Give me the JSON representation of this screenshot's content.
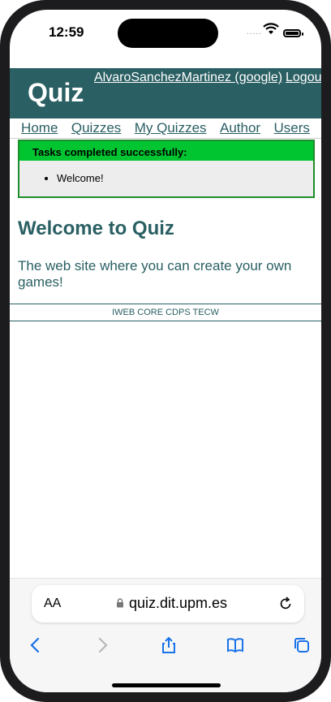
{
  "status": {
    "time": "12:59",
    "signal": "....."
  },
  "site": {
    "logo": "Quiz",
    "user_link": "AlvaroSanchezMartinez (google)",
    "logout": "Logout",
    "nav": [
      "Home",
      "Quizzes",
      "My Quizzes",
      "Author",
      "Users"
    ],
    "flash_title": "Tasks completed successfully:",
    "flash_items": [
      "Welcome!"
    ],
    "welcome_title": "Welcome to Quiz",
    "welcome_text": "The web site where you can create your own games!",
    "footer": "IWEB CORE CDPS TECW"
  },
  "browser": {
    "aa_label": "AA",
    "url": "quiz.dit.upm.es",
    "icons": [
      "back-icon",
      "forward-icon",
      "share-icon",
      "bookmarks-icon",
      "tabs-icon",
      "reload-icon",
      "lock-icon"
    ]
  },
  "colors": {
    "header_bg": "#2a5f63",
    "flash_green": "#00c531",
    "link": "#2a5f63"
  }
}
